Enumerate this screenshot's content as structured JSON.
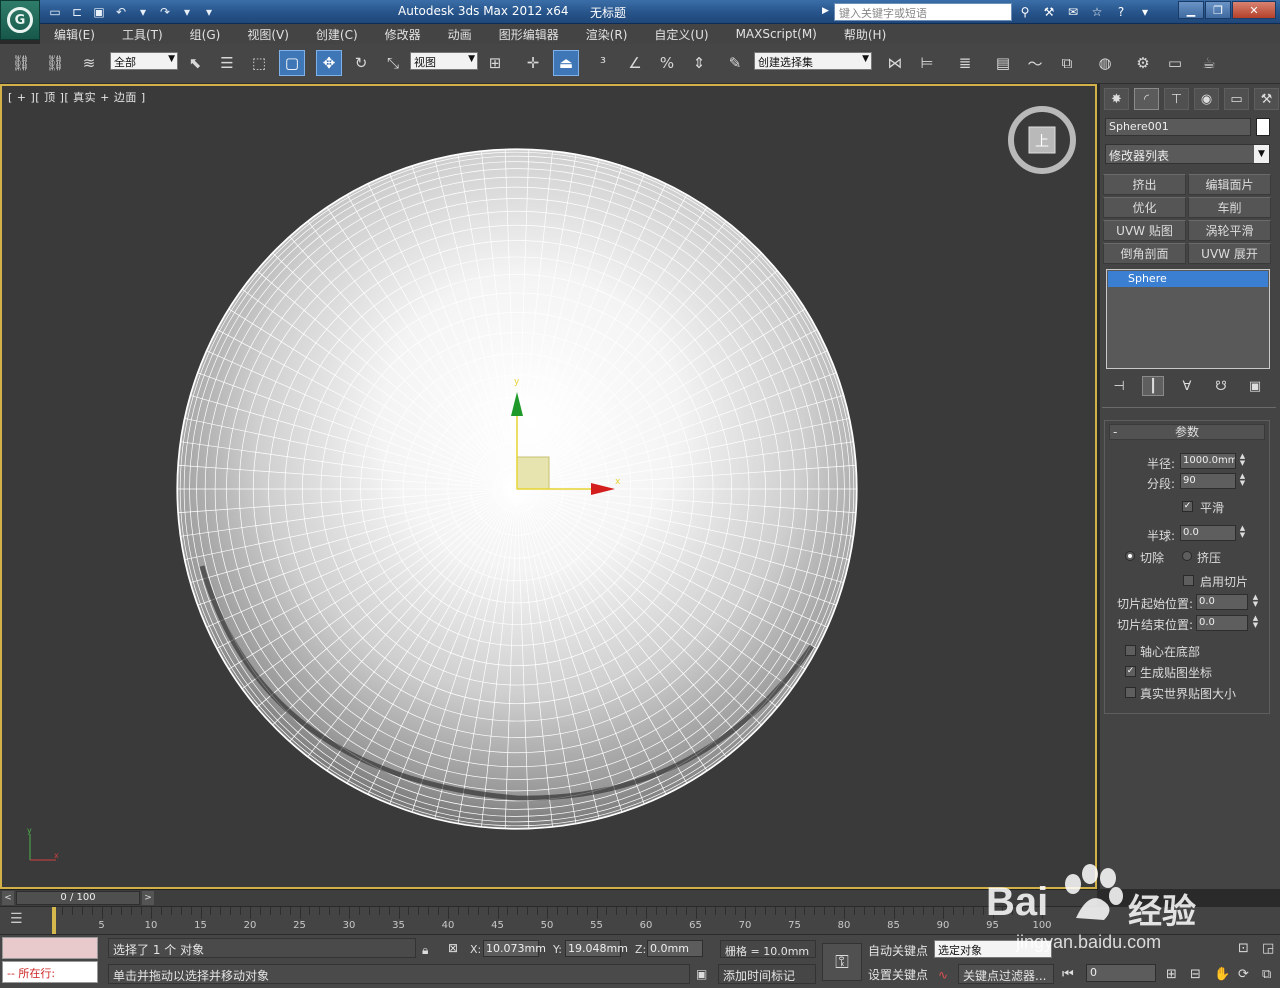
{
  "titlebar": {
    "app_title": "Autodesk 3ds Max  2012 x64",
    "document_title": "无标题",
    "search_placeholder": "键入关键字或短语"
  },
  "menu": {
    "items": [
      "编辑(E)",
      "工具(T)",
      "组(G)",
      "视图(V)",
      "创建(C)",
      "修改器",
      "动画",
      "图形编辑器",
      "渲染(R)",
      "自定义(U)",
      "MAXScript(M)",
      "帮助(H)"
    ]
  },
  "toolbar": {
    "selection_filter": "全部",
    "ref_coord": "视图",
    "named_selection": "创建选择集"
  },
  "viewport": {
    "label": "[ + ][ 顶 ][ 真实 + 边面 ]",
    "axis_x": "x",
    "axis_y": "y",
    "viewcube_face": "上"
  },
  "command_panel": {
    "object_name": "Sphere001",
    "object_color": "#ffffff",
    "modifier_list": "修改器列表",
    "modifier_buttons": [
      "挤出",
      "编辑面片",
      "优化",
      "车削",
      "UVW 贴图",
      "涡轮平滑",
      "倒角剖面",
      "UVW 展开"
    ],
    "stack_items": [
      "Sphere"
    ],
    "params": {
      "title": "参数",
      "radius_label": "半径:",
      "radius_value": "1000.0mm",
      "segments_label": "分段:",
      "segments_value": "90",
      "smooth_label": "平滑",
      "smooth_checked": true,
      "hemisphere_label": "半球:",
      "hemisphere_value": "0.0",
      "chop_label": "切除",
      "squash_label": "挤压",
      "slice_on_label": "启用切片",
      "slice_from_label": "切片起始位置:",
      "slice_from_value": "0.0",
      "slice_to_label": "切片结束位置:",
      "slice_to_value": "0.0",
      "base_to_pivot_label": "轴心在底部",
      "gen_mapping_label": "生成贴图坐标",
      "real_world_label": "真实世界贴图大小"
    }
  },
  "timeline": {
    "frame_display": "0 / 100",
    "ticks": [
      "0",
      "5",
      "10",
      "15",
      "20",
      "25",
      "30",
      "35",
      "40",
      "45",
      "50",
      "55",
      "60",
      "65",
      "70",
      "75",
      "80",
      "85",
      "90",
      "95",
      "100"
    ]
  },
  "status": {
    "mxs_line": "--  所在行:",
    "selected": "选择了 1 个 对象",
    "prompt": "单击并拖动以选择并移动对象",
    "x_label": "X:",
    "x_value": "10.073mm",
    "y_label": "Y:",
    "y_value": "19.048mm",
    "z_label": "Z:",
    "z_value": "0.0mm",
    "grid": "栅格 = 10.0mm",
    "add_time_tag": "添加时间标记",
    "auto_key": "自动关键点",
    "selected_object": "选定对象",
    "set_key": "设置关键点",
    "key_filters": "关键点过滤器...",
    "frame": "0"
  },
  "watermark": {
    "brand": "Bai",
    "brand_cn": "经验",
    "url": "jingyan.baidu.com"
  }
}
